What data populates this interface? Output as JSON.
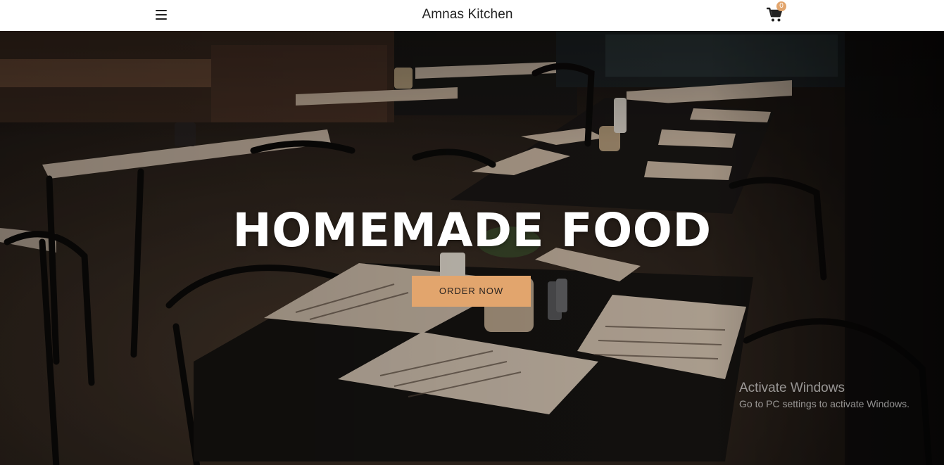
{
  "navbar": {
    "brand": "Amnas Kitchen",
    "menu_icon": "hamburger-menu-icon",
    "cart_icon": "shopping-cart-icon",
    "cart_count": "0"
  },
  "hero": {
    "title": "HOMEMADE FOOD",
    "cta_label": "ORDER NOW",
    "background": "restaurant-interior-photo"
  },
  "colors": {
    "accent": "#e2a56d",
    "navbar_bg": "#ffffff",
    "text_dark": "#222222"
  },
  "os_watermark": {
    "title": "Activate Windows",
    "subtitle": "Go to PC settings to activate Windows."
  }
}
